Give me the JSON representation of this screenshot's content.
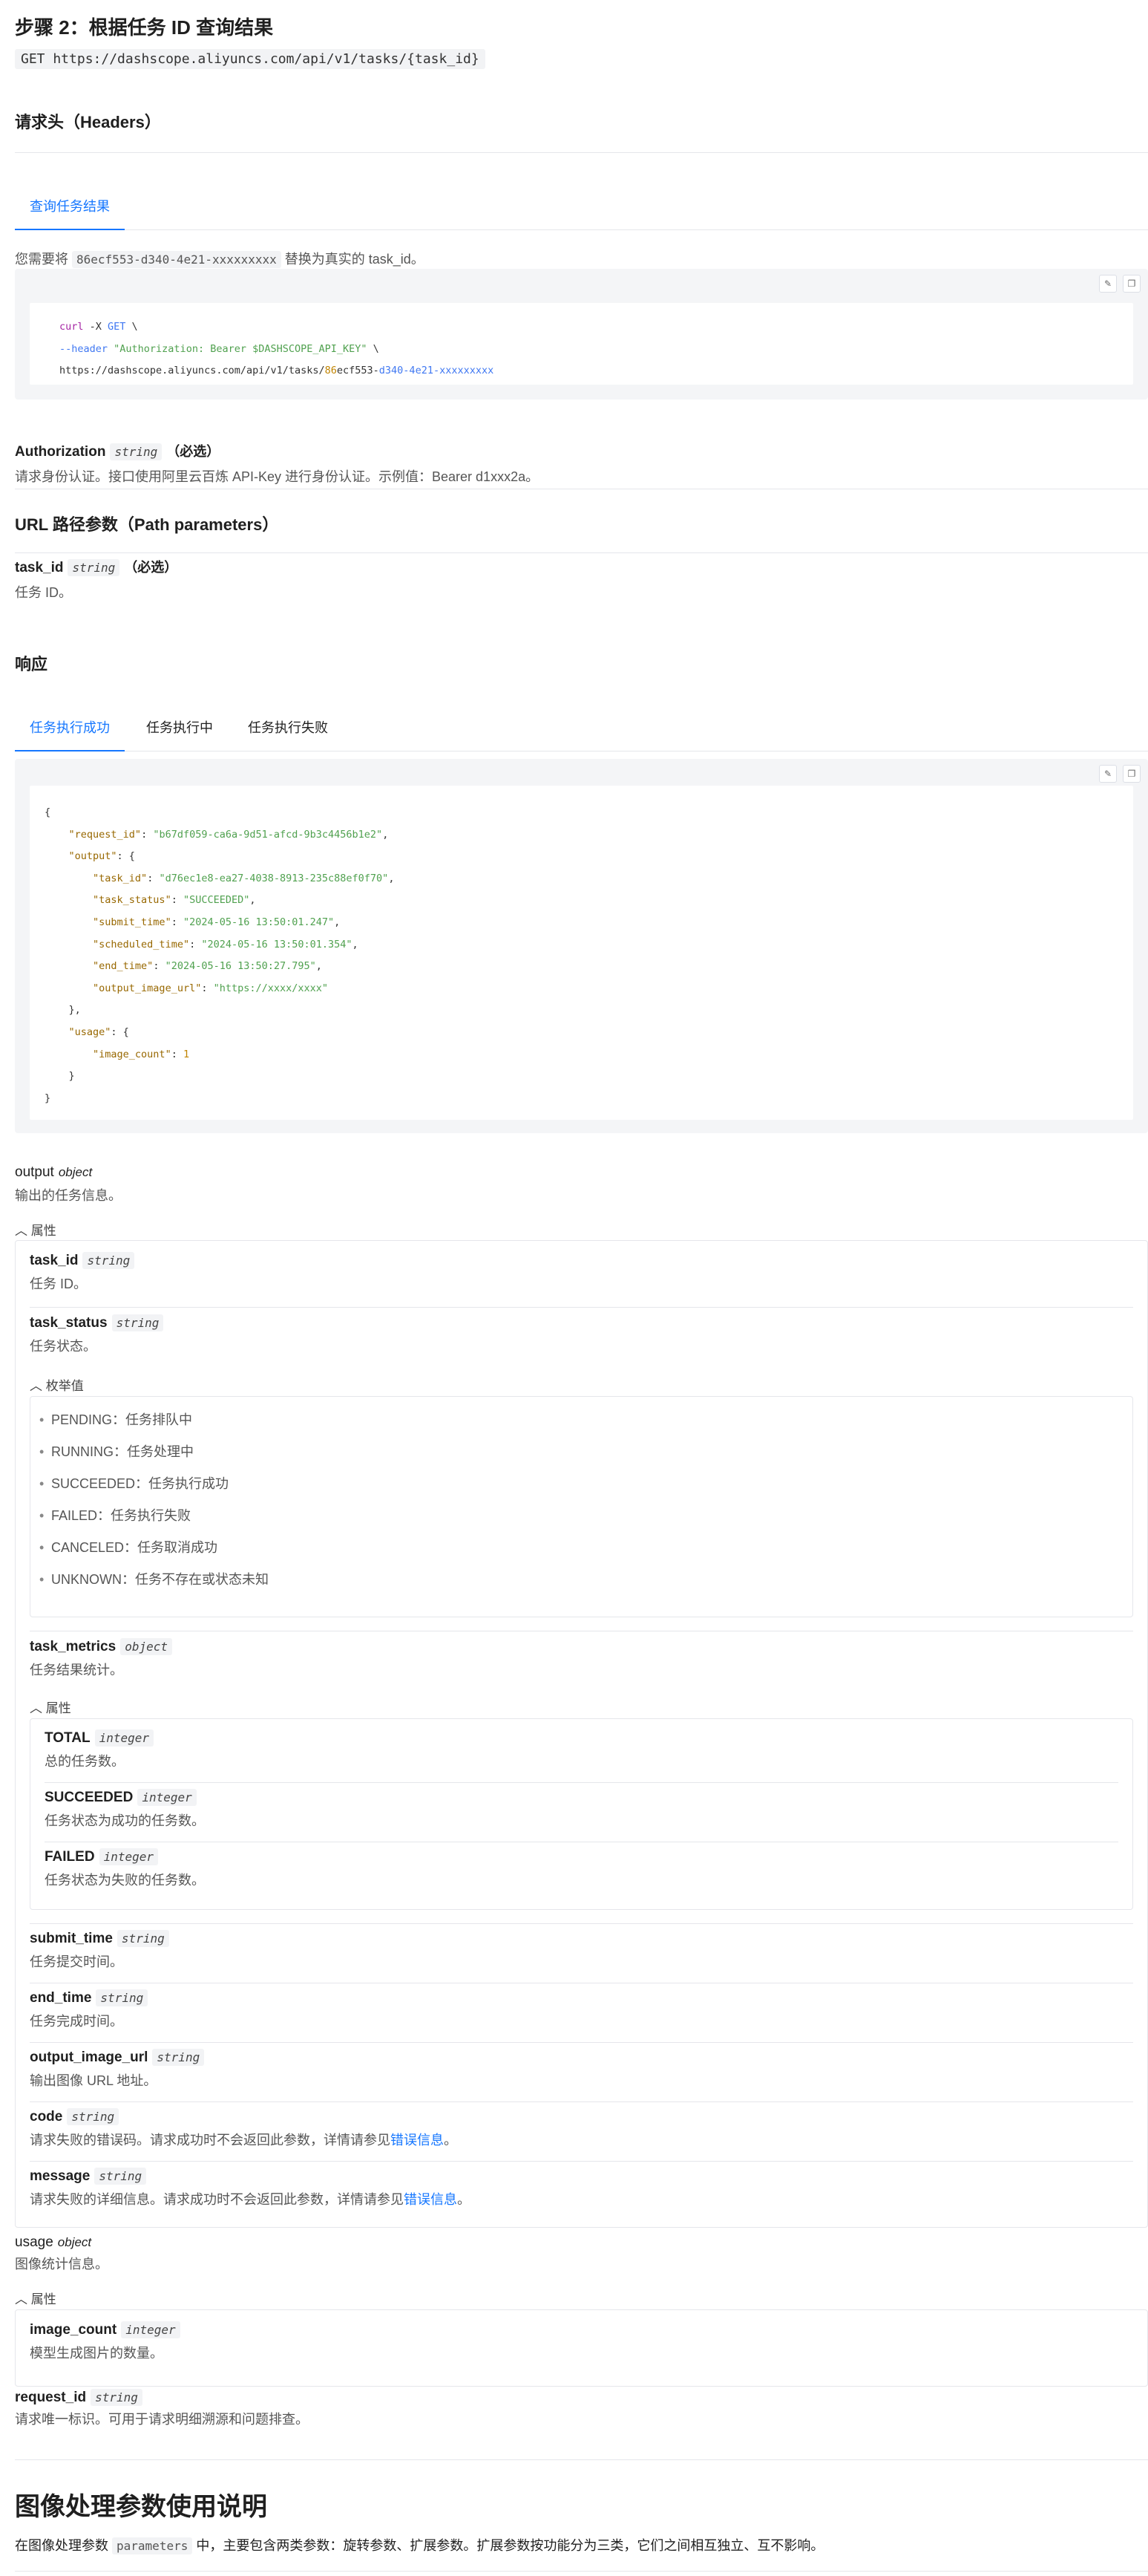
{
  "step_title": "步骤 2：根据任务 ID 查询结果",
  "get_line": "GET https://dashscope.aliyuncs.com/api/v1/tasks/{task_id}",
  "headers_title": "请求头（Headers）",
  "request_tab": "查询任务结果",
  "replace_note": {
    "pre": "您需要将 ",
    "code": "86ecf553-d340-4e21-xxxxxxxxx",
    "post": " 替换为真实的 task_id。"
  },
  "icons": {
    "copy_left": "note-icon",
    "copy_right": "copy-icon",
    "caret": "chevron-up-icon"
  },
  "curl": {
    "l1_cmd": "curl",
    "l1_opt": " -X ",
    "l1_method": "GET",
    "l1_end": " \\",
    "l2_opt": "--header ",
    "l2_str": "\"Authorization: Bearer $DASHSCOPE_API_KEY\"",
    "l2_end": " \\",
    "l3_a": "https://dashscope.aliyuncs.com/api/v1/tasks/",
    "l3_b": "86",
    "l3_c": "ecf553-",
    "l3_d": "d340-4e21-xxxxxxxxx"
  },
  "authorization": {
    "name": "Authorization",
    "type": "string",
    "req": "（必选）",
    "desc": "请求身份认证。接口使用阿里云百炼 API-Key 进行身份认证。示例值：Bearer d1xxx2a。"
  },
  "url_params_title": "URL 路径参数（Path parameters）",
  "task_id_param": {
    "name": "task_id",
    "type": "string",
    "req": "（必选）",
    "desc": "任务 ID。"
  },
  "response_title": "响应",
  "response_tabs": [
    "任务执行成功",
    "任务执行中",
    "任务执行失败"
  ],
  "json_lines": {
    "open": "{",
    "request_id_key": "\"request_id\"",
    "request_id_val": "\"b67df059-ca6a-9d51-afcd-9b3c4456b1e2\"",
    "output_key": "\"output\"",
    "task_id_key": "\"task_id\"",
    "task_id_val": "\"d76ec1e8-ea27-4038-8913-235c88ef0f70\"",
    "task_status_key": "\"task_status\"",
    "task_status_val": "\"SUCCEEDED\"",
    "submit_key": "\"submit_time\"",
    "submit_val": "\"2024-05-16 13:50:01.247\"",
    "scheduled_key": "\"scheduled_time\"",
    "scheduled_val": "\"2024-05-16 13:50:01.354\"",
    "end_key": "\"end_time\"",
    "end_val": "\"2024-05-16 13:50:27.795\"",
    "url_key": "\"output_image_url\"",
    "url_val": "\"https://xxxx/xxxx\"",
    "usage_key": "\"usage\"",
    "count_key": "\"image_count\"",
    "count_val": "1",
    "close_inner": "},",
    "close_usage": "}",
    "close": "}"
  },
  "output": {
    "name": "output",
    "type": "object",
    "desc": "输出的任务信息。",
    "toggle": "属性"
  },
  "fields": {
    "task_id": {
      "name": "task_id",
      "type": "string",
      "desc": "任务 ID。"
    },
    "task_status": {
      "name": "task_status",
      "type": "string",
      "desc": "任务状态。",
      "toggle": "枚举值"
    },
    "task_metrics": {
      "name": "task_metrics",
      "type": "object",
      "desc": "任务结果统计。",
      "toggle": "属性"
    },
    "total": {
      "name": "TOTAL",
      "type": "integer",
      "desc": "总的任务数。"
    },
    "succeeded": {
      "name": "SUCCEEDED",
      "type": "integer",
      "desc": "任务状态为成功的任务数。"
    },
    "failed": {
      "name": "FAILED",
      "type": "integer",
      "desc": "任务状态为失败的任务数。"
    },
    "submit_time": {
      "name": "submit_time",
      "type": "string",
      "desc": "任务提交时间。"
    },
    "end_time": {
      "name": "end_time",
      "type": "string",
      "desc": "任务完成时间。"
    },
    "output_image_url": {
      "name": "output_image_url",
      "type": "string",
      "desc": "输出图像 URL 地址。"
    },
    "code": {
      "name": "code",
      "type": "string",
      "desc": "请求失败的错误码。请求成功时不会返回此参数，详情请参见",
      "link": "错误信息",
      "end": "。"
    },
    "message": {
      "name": "message",
      "type": "string",
      "desc": "请求失败的详细信息。请求成功时不会返回此参数，详情请参见",
      "link": "错误信息",
      "end": "。"
    }
  },
  "enum_values": [
    "PENDING：任务排队中",
    "RUNNING：任务处理中",
    "SUCCEEDED：任务执行成功",
    "FAILED：任务执行失败",
    "CANCELED：任务取消成功",
    "UNKNOWN：任务不存在或状态未知"
  ],
  "usage": {
    "name": "usage",
    "type": "object",
    "desc": "图像统计信息。",
    "toggle": "属性"
  },
  "image_count": {
    "name": "image_count",
    "type": "integer",
    "desc": "模型生成图片的数量。"
  },
  "request_id": {
    "name": "request_id",
    "type": "string",
    "desc": "请求唯一标识。可用于请求明细溯源和问题排查。"
  },
  "guide_title": "图像处理参数使用说明",
  "guide_text": {
    "pre": "在图像处理参数 ",
    "code": "parameters",
    "post": " 中，主要包含两类参数：旋转参数、扩展参数。扩展参数按功能分为三类，它们之间相互独立、互不影响。"
  }
}
